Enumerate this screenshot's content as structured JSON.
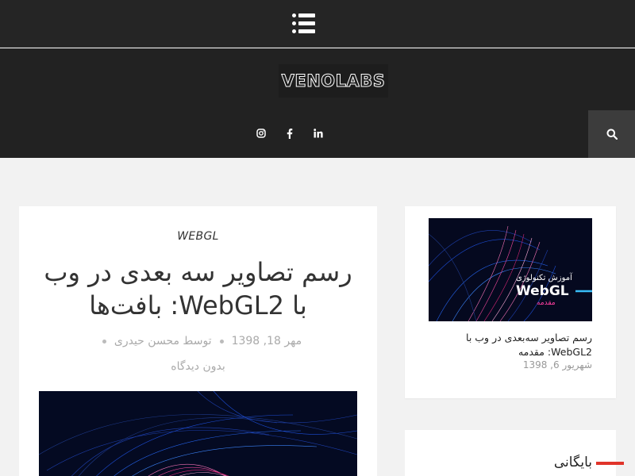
{
  "header": {
    "menu_icon": "menu-list-icon",
    "logo": "VENOLABS",
    "socials": [
      {
        "name": "instagram",
        "icon": "instagram-icon"
      },
      {
        "name": "facebook",
        "icon": "facebook-icon"
      },
      {
        "name": "linkedin",
        "icon": "linkedin-icon"
      }
    ],
    "search_icon": "search-icon"
  },
  "post": {
    "category": "WEBGL",
    "title": "رسم تصاویر سه بعدی در وب با WebGL2: بافت‌ها",
    "date": "مهر 18, 1398",
    "author": "توسط محسن حیدری",
    "comments": "بدون دیدگاه"
  },
  "sidebar": {
    "recent_post": {
      "thumb_line1": "آموزش تکنولوژی",
      "thumb_line2": "WebGL",
      "thumb_line3": "مقدمه",
      "title": "رسم تصاویر سه‌بعدی در وب با WebGL2: مقدمه",
      "date": "شهریور 6, 1398"
    },
    "archive_title": "بایگانی"
  },
  "colors": {
    "header_bg": "#252525",
    "page_bg": "#f2f2f2",
    "accent": "#e0342a"
  }
}
